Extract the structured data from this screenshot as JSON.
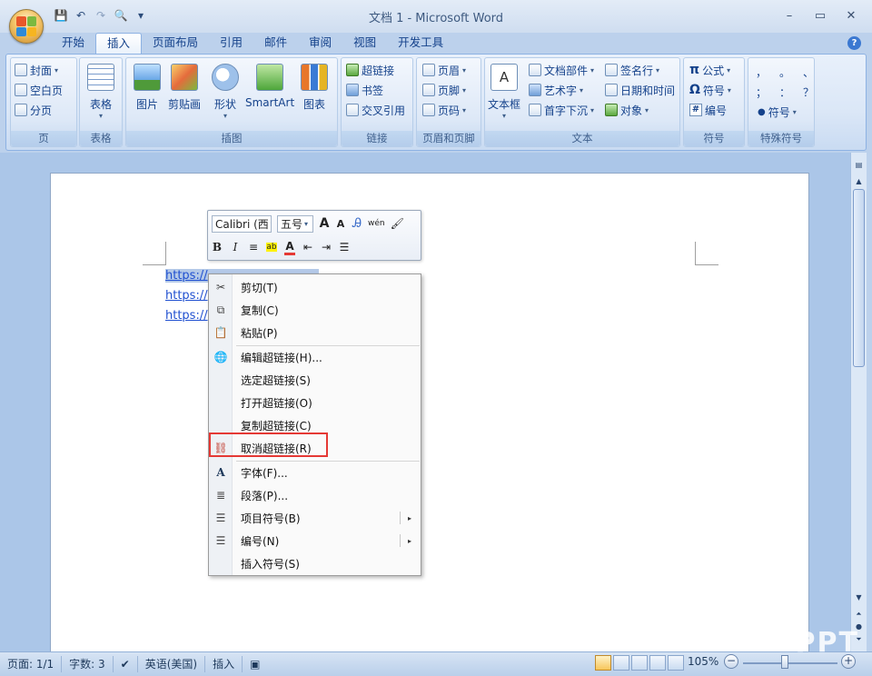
{
  "window": {
    "title": "文档 1 - Microsoft Word",
    "minimize": "–",
    "maximize": "▭",
    "close": "✕"
  },
  "quick_access": {
    "customize": "▾"
  },
  "tabs": [
    "开始",
    "插入",
    "页面布局",
    "引用",
    "邮件",
    "审阅",
    "视图",
    "开发工具"
  ],
  "active_tab": "插入",
  "ribbon": {
    "pages": {
      "name": "页",
      "items": [
        "封面",
        "空白页",
        "分页"
      ]
    },
    "tables": {
      "name": "表格",
      "button": "表格"
    },
    "illustrations": {
      "name": "插图",
      "buttons": [
        "图片",
        "剪贴画",
        "形状",
        "SmartArt",
        "图表"
      ]
    },
    "links": {
      "name": "链接",
      "items": [
        "超链接",
        "书签",
        "交叉引用"
      ]
    },
    "header_footer": {
      "name": "页眉和页脚",
      "items": [
        "页眉",
        "页脚",
        "页码"
      ]
    },
    "text": {
      "name": "文本",
      "textbox": "文本框",
      "items_left": [
        "文档部件",
        "艺术字",
        "首字下沉"
      ],
      "items_right": [
        "签名行",
        "日期和时间",
        "对象"
      ]
    },
    "symbols": {
      "name": "符号",
      "items": [
        "公式",
        "符号",
        "编号"
      ],
      "glyphs": [
        "π",
        "Ω",
        "#"
      ]
    },
    "special": {
      "name": "特殊符号",
      "row1": [
        "，",
        "。",
        "、"
      ],
      "row2": [
        "；",
        "：",
        "？"
      ],
      "button": "符号"
    }
  },
  "document": {
    "links": [
      "https://",
      "https://",
      "https://"
    ]
  },
  "mini_toolbar": {
    "font": "Calibri (西",
    "size": "五号",
    "grow": "A",
    "shrink": "A",
    "bold": "B",
    "italic": "I",
    "center": "≡",
    "font_color": "A",
    "phonetic": "wén"
  },
  "context_menu": {
    "items": [
      {
        "label": "剪切(T)",
        "icon": "✂"
      },
      {
        "label": "复制(C)",
        "icon": "⧉"
      },
      {
        "label": "粘贴(P)",
        "icon": "📋"
      },
      {
        "label": "编辑超链接(H)...",
        "icon": "🌐"
      },
      {
        "label": "选定超链接(S)",
        "icon": ""
      },
      {
        "label": "打开超链接(O)",
        "icon": ""
      },
      {
        "label": "复制超链接(C)",
        "icon": ""
      },
      {
        "label": "取消超链接(R)",
        "icon": "⛓"
      },
      {
        "label": "字体(F)...",
        "icon": "A"
      },
      {
        "label": "段落(P)...",
        "icon": "≣"
      },
      {
        "label": "项目符号(B)",
        "icon": "☰",
        "submenu": "▸"
      },
      {
        "label": "编号(N)",
        "icon": "☰",
        "submenu": "▸"
      },
      {
        "label": "插入符号(S)",
        "icon": ""
      }
    ]
  },
  "status": {
    "page": "页面: 1/1",
    "words": "字数: 3",
    "language": "英语(美国)",
    "mode": "插入",
    "zoom": "105%",
    "zoom_minus": "−",
    "zoom_plus": "+"
  },
  "watermark": "PPT",
  "colors": {
    "link": "#1f4fd0",
    "highlight": "#e53935",
    "ribbon": "#dbe7f7"
  }
}
